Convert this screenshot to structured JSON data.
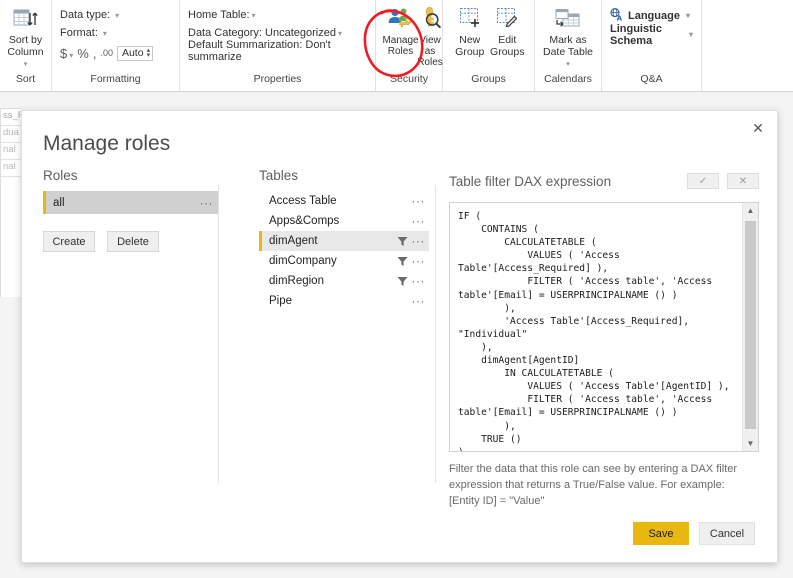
{
  "ribbon": {
    "groups": {
      "sort": {
        "label": "Sort",
        "sort_by_column": "Sort by\nColumn",
        "sort_by_column_line1": "Sort by",
        "sort_by_column_line2": "Column",
        "icon": "sort-table-icon"
      },
      "formatting": {
        "label": "Formatting",
        "data_type_label": "Data type:",
        "format_label": "Format:",
        "currency_icon": "$",
        "percent_icon": "%",
        "comma_icon": ",",
        "decimal_icon": ".00",
        "decimal_value": "Auto"
      },
      "properties": {
        "label": "Properties",
        "home_table": "Home Table:",
        "data_category": "Data Category: Uncategorized",
        "default_summarization": "Default Summarization: Don't summarize"
      },
      "security": {
        "label": "Security",
        "manage_roles_line1": "Manage",
        "manage_roles_line2": "Roles",
        "view_as_roles_line1": "View as",
        "view_as_roles_line2": "Roles"
      },
      "groups": {
        "label": "Groups",
        "new_group_line1": "New",
        "new_group_line2": "Group",
        "edit_groups_line1": "Edit",
        "edit_groups_line2": "Groups"
      },
      "calendars": {
        "label": "Calendars",
        "mark_as_date_table_line1": "Mark as",
        "mark_as_date_table_line2": "Date Table"
      },
      "qa": {
        "label": "Q&A",
        "language": "Language",
        "linguistic_schema": "Linguistic Schema"
      }
    }
  },
  "annotation": {
    "shape": "red-ellipse",
    "color": "#ee1c25",
    "target": "manage-roles-button"
  },
  "background_table": {
    "cells": [
      "ss_R",
      "dua",
      "nal",
      "nal"
    ]
  },
  "dialog": {
    "title": "Manage roles",
    "close_icon": "close-icon",
    "roles": {
      "heading": "Roles",
      "items": [
        {
          "name": "all",
          "selected": true,
          "menu": "···"
        }
      ],
      "create_label": "Create",
      "delete_label": "Delete"
    },
    "tables": {
      "heading": "Tables",
      "items": [
        {
          "name": "Access Table",
          "selected": false,
          "has_filter": false
        },
        {
          "name": "Apps&Comps",
          "selected": false,
          "has_filter": false
        },
        {
          "name": "dimAgent",
          "selected": true,
          "has_filter": true
        },
        {
          "name": "dimCompany",
          "selected": false,
          "has_filter": true
        },
        {
          "name": "dimRegion",
          "selected": false,
          "has_filter": true
        },
        {
          "name": "Pipe",
          "selected": false,
          "has_filter": false
        }
      ],
      "row_menu": "···"
    },
    "dax": {
      "heading": "Table filter DAX expression",
      "accept_icon": "checkmark-icon",
      "cancel_icon": "x-icon",
      "expression": "IF (\n    CONTAINS (\n        CALCULATETABLE (\n            VALUES ( 'Access Table'[Access_Required] ),\n            FILTER ( 'Access table', 'Access table'[Email] = USERPRINCIPALNAME () )\n        ),\n        'Access Table'[Access_Required], \"Individual\"\n    ),\n    dimAgent[AgentID]\n        IN CALCULATETABLE (\n            VALUES ( 'Access Table'[AgentID] ),\n            FILTER ( 'Access table', 'Access table'[Email] = USERPRINCIPALNAME () )\n        ),\n    TRUE ()\n)",
      "help_text": "Filter the data that this role can see by entering a DAX filter expression that returns a True/False value. For example: [Entity ID] = \"Value\"",
      "scroll_up_icon": "chevron-up-icon",
      "scroll_down_icon": "chevron-down-icon"
    },
    "footer": {
      "save_label": "Save",
      "cancel_label": "Cancel"
    }
  },
  "colors": {
    "accent_yellow": "#e8b710",
    "annotation_red": "#ee1c25",
    "selection_gray": "#d0d0d0"
  }
}
